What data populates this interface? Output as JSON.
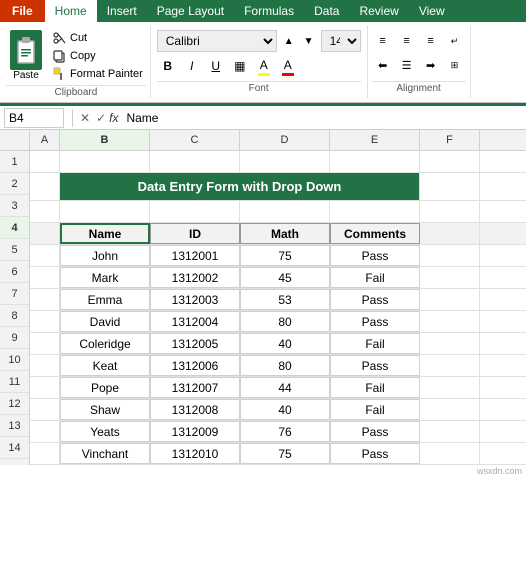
{
  "ribbon": {
    "tabs": [
      "File",
      "Home",
      "Insert",
      "Page Layout",
      "Formulas",
      "Data",
      "Review",
      "View"
    ],
    "active_tab": "Home",
    "file_tab": "File",
    "clipboard": {
      "label": "Clipboard",
      "paste_label": "Paste",
      "cut_label": "Cut",
      "copy_label": "Copy",
      "format_painter_label": "Format Painter"
    },
    "font": {
      "label": "Font",
      "font_name": "Calibri",
      "font_size": "14",
      "bold": "B",
      "italic": "I",
      "underline": "U"
    },
    "alignment": {
      "label": "Alignment"
    }
  },
  "formula_bar": {
    "cell_ref": "B4",
    "formula_value": "Name",
    "fx_label": "fx"
  },
  "spreadsheet": {
    "title": "Data Entry Form with Drop Down",
    "columns": [
      "A",
      "B",
      "C",
      "D",
      "E",
      "F"
    ],
    "col_headers": [
      "",
      "B",
      "C",
      "D",
      "E",
      ""
    ],
    "rows": [
      {
        "row": 1,
        "cells": [
          "",
          "",
          "",
          "",
          "",
          ""
        ]
      },
      {
        "row": 2,
        "cells": [
          "",
          "Data Entry Form with Drop Down",
          "",
          "",
          "",
          ""
        ]
      },
      {
        "row": 3,
        "cells": [
          "",
          "",
          "",
          "",
          "",
          ""
        ]
      },
      {
        "row": 4,
        "cells": [
          "",
          "Name",
          "ID",
          "Math",
          "Comments",
          ""
        ]
      },
      {
        "row": 5,
        "cells": [
          "",
          "John",
          "1312001",
          "75",
          "Pass",
          ""
        ]
      },
      {
        "row": 6,
        "cells": [
          "",
          "Mark",
          "1312002",
          "45",
          "Fail",
          ""
        ]
      },
      {
        "row": 7,
        "cells": [
          "",
          "Emma",
          "1312003",
          "53",
          "Pass",
          ""
        ]
      },
      {
        "row": 8,
        "cells": [
          "",
          "David",
          "1312004",
          "80",
          "Pass",
          ""
        ]
      },
      {
        "row": 9,
        "cells": [
          "",
          "Coleridge",
          "1312005",
          "40",
          "Fail",
          ""
        ]
      },
      {
        "row": 10,
        "cells": [
          "",
          "Keat",
          "1312006",
          "80",
          "Pass",
          ""
        ]
      },
      {
        "row": 11,
        "cells": [
          "",
          "Pope",
          "1312007",
          "44",
          "Fail",
          ""
        ]
      },
      {
        "row": 12,
        "cells": [
          "",
          "Shaw",
          "1312008",
          "40",
          "Fail",
          ""
        ]
      },
      {
        "row": 13,
        "cells": [
          "",
          "Yeats",
          "1312009",
          "76",
          "Pass",
          ""
        ]
      },
      {
        "row": 14,
        "cells": [
          "",
          "Vinchant",
          "1312010",
          "75",
          "Pass",
          ""
        ]
      }
    ]
  }
}
